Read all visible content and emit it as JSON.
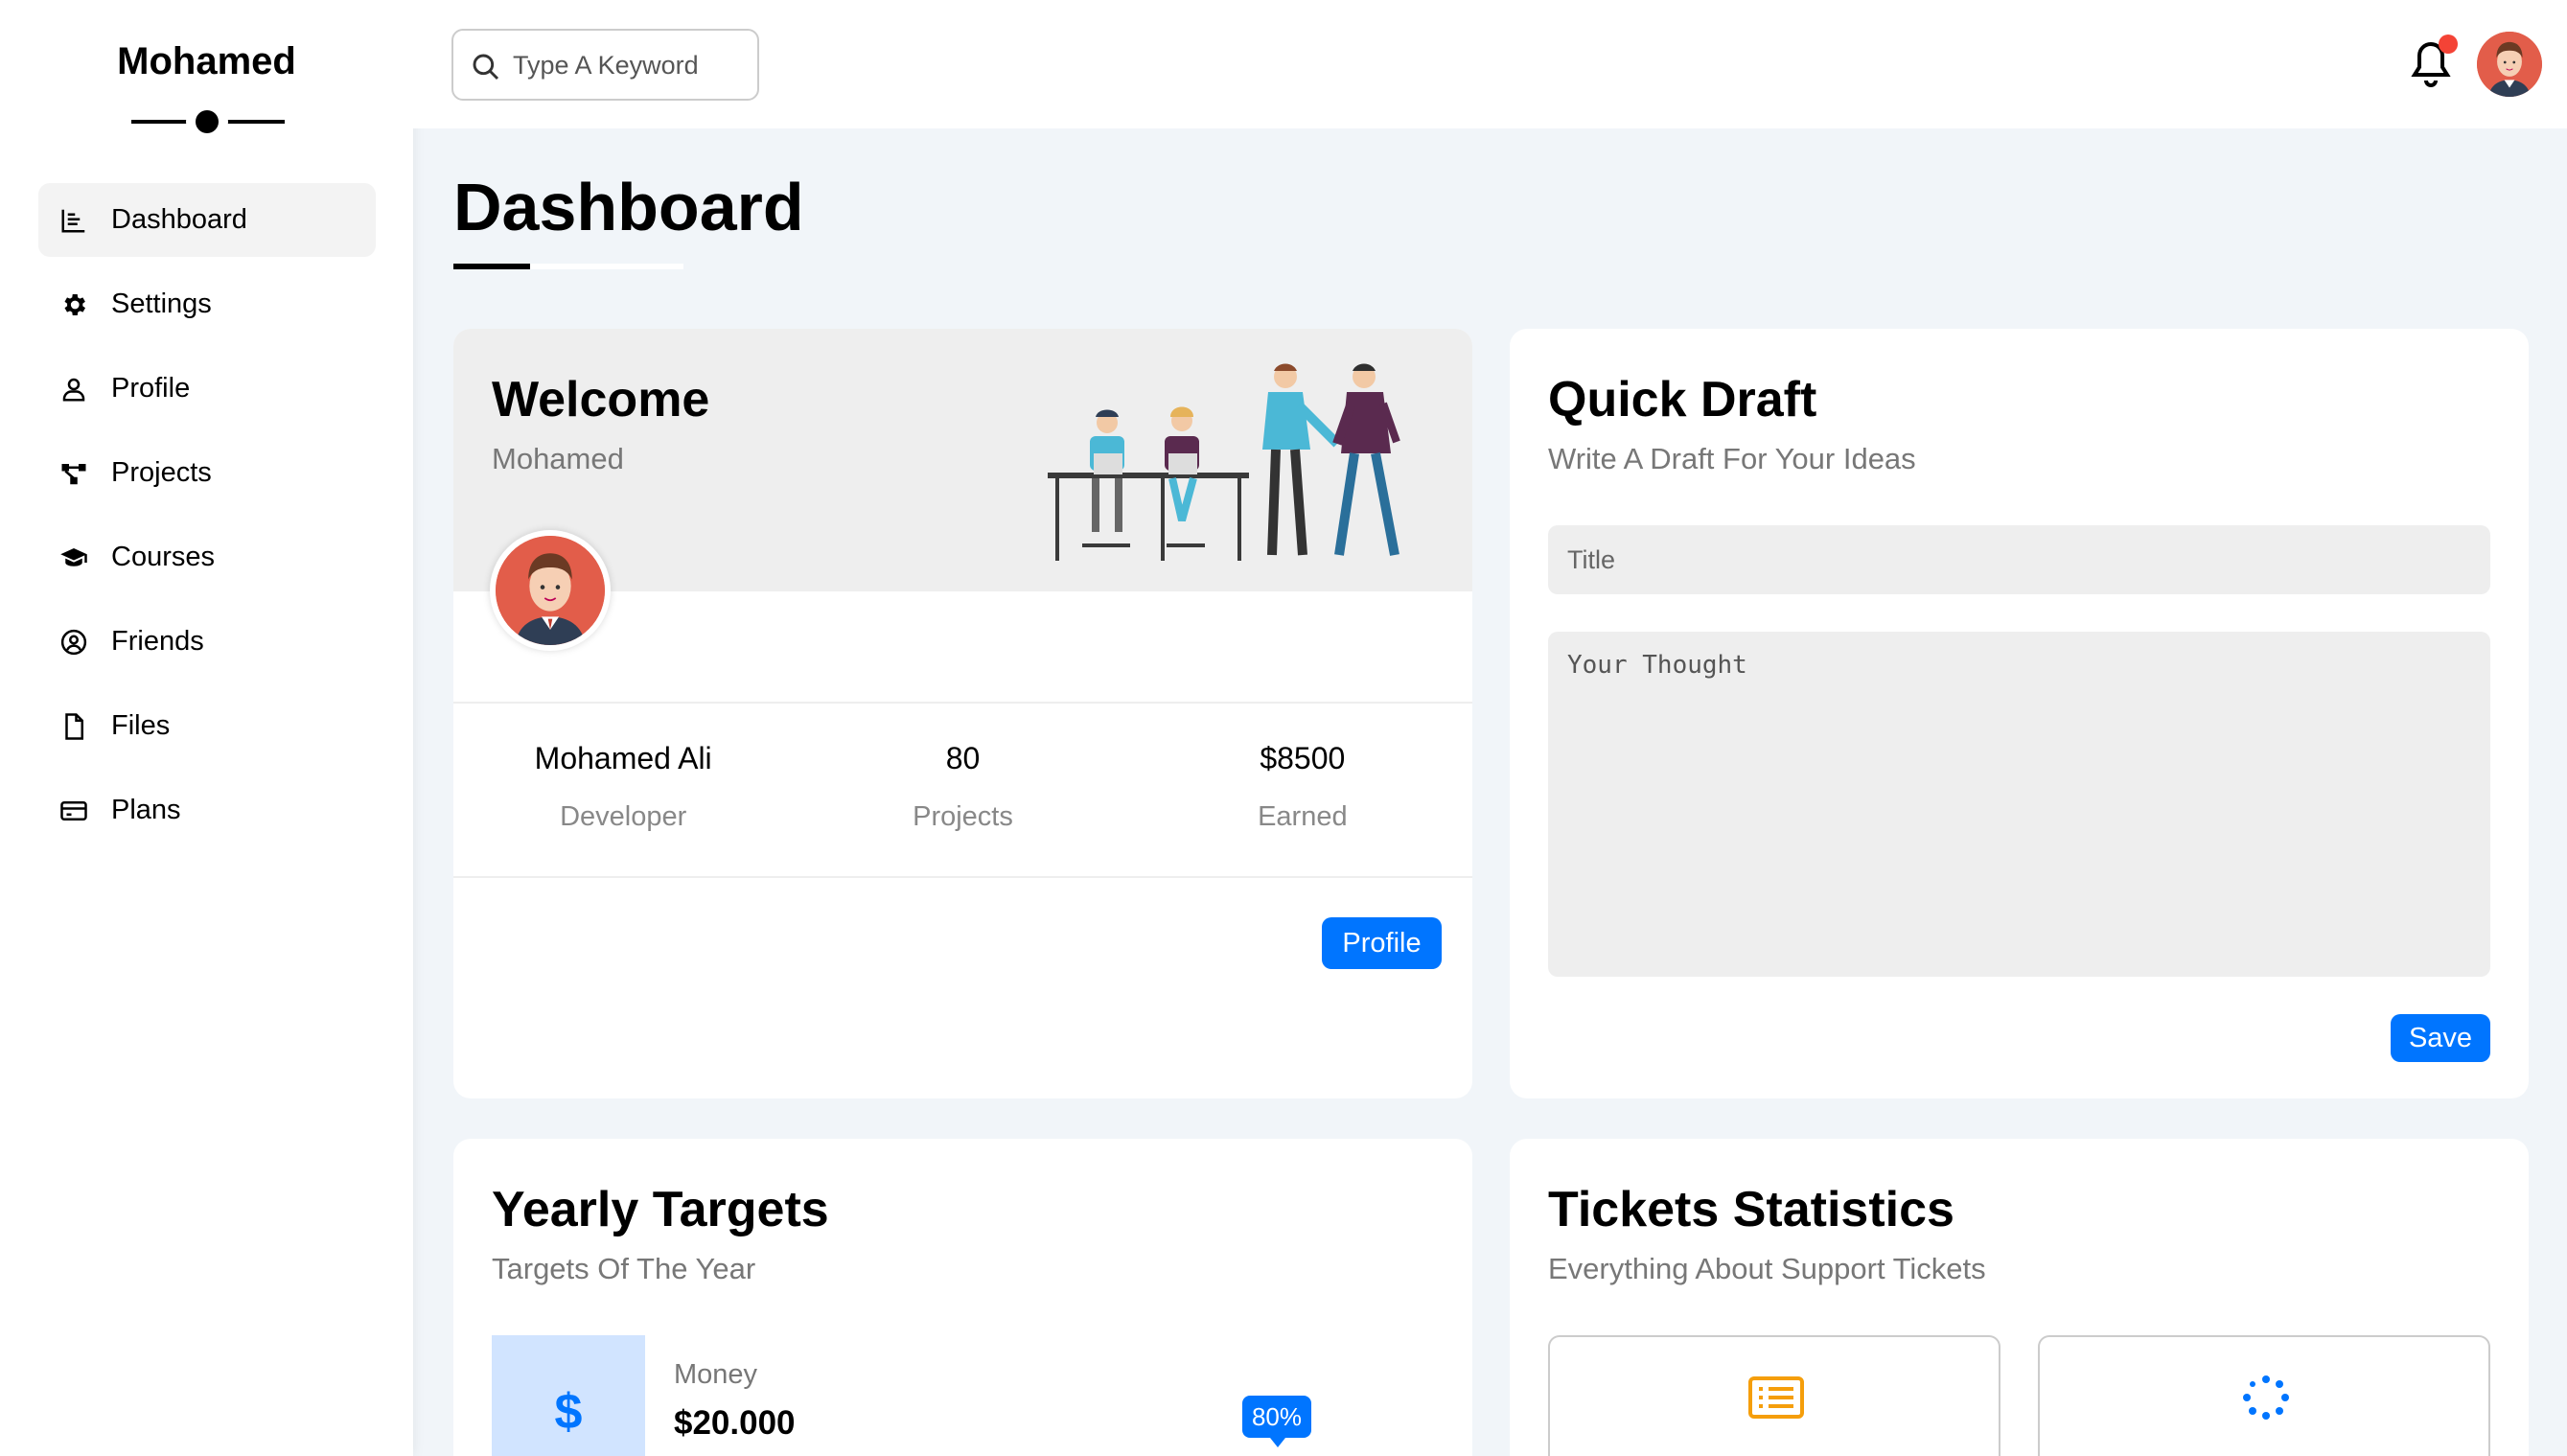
{
  "sidebar": {
    "brand": "Mohamed",
    "items": [
      {
        "label": "Dashboard",
        "icon": "chart-icon",
        "active": true
      },
      {
        "label": "Settings",
        "icon": "gear-icon"
      },
      {
        "label": "Profile",
        "icon": "user-icon"
      },
      {
        "label": "Projects",
        "icon": "diagram-icon"
      },
      {
        "label": "Courses",
        "icon": "graduation-cap-icon"
      },
      {
        "label": "Friends",
        "icon": "user-circle-icon"
      },
      {
        "label": "Files",
        "icon": "file-icon"
      },
      {
        "label": "Plans",
        "icon": "credit-card-icon"
      }
    ]
  },
  "header": {
    "search_placeholder": "Type A Keyword",
    "notification_dot_color": "#f44336"
  },
  "page": {
    "title": "Dashboard"
  },
  "welcome": {
    "title": "Welcome",
    "subtitle": "Mohamed",
    "stats": [
      {
        "value": "Mohamed Ali",
        "label": "Developer"
      },
      {
        "value": "80",
        "label": "Projects"
      },
      {
        "value": "$8500",
        "label": "Earned"
      }
    ],
    "button": "Profile"
  },
  "draft": {
    "title": "Quick Draft",
    "subtitle": "Write A Draft For Your Ideas",
    "title_placeholder": "Title",
    "text_placeholder": "Your Thought",
    "button": "Save"
  },
  "targets": {
    "title": "Yearly Targets",
    "subtitle": "Targets Of The Year",
    "item": {
      "icon": "dollar-icon",
      "symbol": "$",
      "label": "Money",
      "value": "$20.000",
      "progress_label": "80%",
      "progress": 0.8
    }
  },
  "tickets": {
    "title": "Tickets Statistics",
    "subtitle": "Everything About Support Tickets",
    "boxes": [
      {
        "icon": "list-icon",
        "color": "#f59e0b"
      },
      {
        "icon": "spinner-icon",
        "color": "#0075ff"
      }
    ]
  },
  "colors": {
    "accent": "#0075ff",
    "background": "#f1f5f9"
  }
}
